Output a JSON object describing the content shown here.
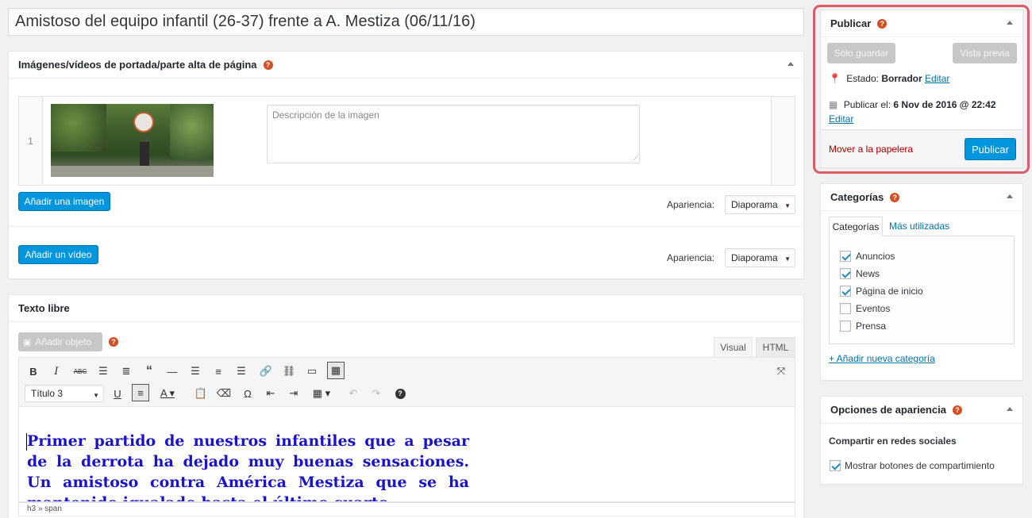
{
  "title": {
    "value": "Amistoso del equipo infantil (26-37) frente a A. Mestiza (06/11/16)"
  },
  "gallery": {
    "heading": "Imágenes/vídeos de portada/parte alta de página",
    "row_number": "1",
    "description_placeholder": "Descripción de la imagen",
    "add_image_label": "Añadir una imagen",
    "add_video_label": "Añadir un vídeo",
    "appearance_label": "Apariencia:",
    "appearance_value": "Diaporama"
  },
  "editor": {
    "heading": "Texto libre",
    "add_object_label": "Añadir objeto",
    "tab_visual": "Visual",
    "tab_html": "HTML",
    "format_value": "Título 3",
    "content": "Primer partido de nuestros infantiles que a pesar de la derrota ha dejado muy buenas sensaciones. Un amistoso contra América Mestiza que se ha mantenido igualado hasta el último cuarto",
    "path": "h3 » span"
  },
  "publish": {
    "heading": "Publicar",
    "save_label": "Sólo guardar",
    "preview_label": "Vista previa",
    "status_label": "Estado:",
    "status_value": "Borrador",
    "edit_label": "Editar",
    "publish_on_label": "Publicar el:",
    "publish_on_value": "6 Nov de 2016 @ 22:42",
    "trash_label": "Mover a la papelera",
    "publish_label": "Publicar"
  },
  "categories": {
    "heading": "Categorías",
    "tab_all": "Categorías",
    "tab_popular": "Más utilizadas",
    "items": [
      {
        "label": "Anuncios",
        "checked": true
      },
      {
        "label": "News",
        "checked": true
      },
      {
        "label": "Página de inicio",
        "checked": true
      },
      {
        "label": "Eventos",
        "checked": false
      },
      {
        "label": "Prensa",
        "checked": false
      }
    ],
    "add_new_label": "+ Añadir nueva categoría"
  },
  "appearance_options": {
    "heading": "Opciones de apariencia",
    "share_label": "Compartir en redes sociales",
    "share_checkbox_label": "Mostrar botones de compartimiento",
    "share_checked": true
  },
  "colors": {
    "accent": "#0096dd",
    "highlight_border": "#e05a63",
    "trash": "#a00",
    "editor_text": "#1a14c8"
  }
}
